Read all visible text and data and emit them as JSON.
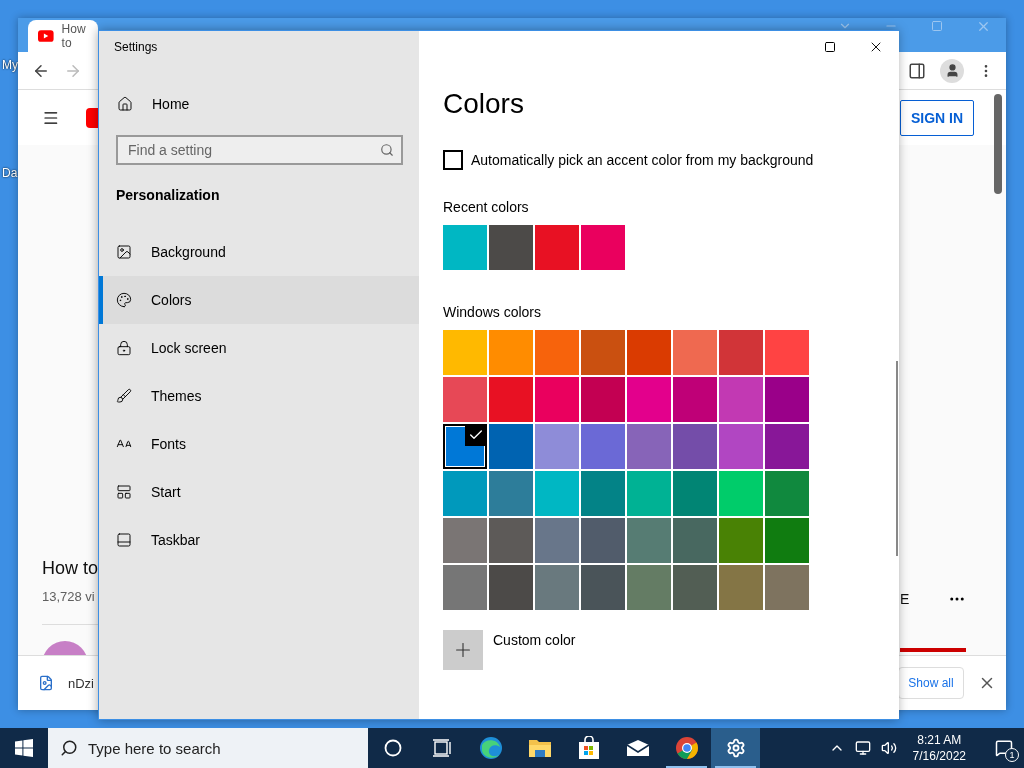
{
  "desktop": {
    "icon_labels": [
      "My",
      "Da"
    ]
  },
  "browser": {
    "tab_title": "How to",
    "sign_in": "SIGN IN",
    "video_title": "How to",
    "views": "13,728 vi",
    "action": "E",
    "download_file": "nDzi",
    "show_all": "Show all"
  },
  "settings": {
    "title": "Settings",
    "home": "Home",
    "search": {
      "placeholder": "Find a setting"
    },
    "section": "Personalization",
    "nav": [
      {
        "label": "Background",
        "kind": "image",
        "selected": false
      },
      {
        "label": "Colors",
        "kind": "palette",
        "selected": true
      },
      {
        "label": "Lock screen",
        "kind": "lock",
        "selected": false
      },
      {
        "label": "Themes",
        "kind": "brush",
        "selected": false
      },
      {
        "label": "Fonts",
        "kind": "fonts",
        "selected": false
      },
      {
        "label": "Start",
        "kind": "start",
        "selected": false
      },
      {
        "label": "Taskbar",
        "kind": "taskbar",
        "selected": false
      }
    ],
    "page": {
      "title": "Colors",
      "auto_accent": {
        "label": "Automatically pick an accent color from my background",
        "checked": false
      },
      "recent_label": "Recent colors",
      "recent_colors": [
        {
          "color": "#00b7c3"
        },
        {
          "color": "#4c4a48"
        },
        {
          "color": "#e81123"
        },
        {
          "color": "#ea005e"
        }
      ],
      "windows_label": "Windows colors",
      "windows_colors": [
        {
          "color": "#ffb900",
          "selected": false
        },
        {
          "color": "#ff8c00",
          "selected": false
        },
        {
          "color": "#f7630c",
          "selected": false
        },
        {
          "color": "#ca5010",
          "selected": false
        },
        {
          "color": "#da3b01",
          "selected": false
        },
        {
          "color": "#ef6950",
          "selected": false
        },
        {
          "color": "#d13438",
          "selected": false
        },
        {
          "color": "#ff4343",
          "selected": false
        },
        {
          "color": "#e74856",
          "selected": false
        },
        {
          "color": "#e81123",
          "selected": false
        },
        {
          "color": "#ea005e",
          "selected": false
        },
        {
          "color": "#c30052",
          "selected": false
        },
        {
          "color": "#e3008c",
          "selected": false
        },
        {
          "color": "#bf0077",
          "selected": false
        },
        {
          "color": "#c239b3",
          "selected": false
        },
        {
          "color": "#9a0089",
          "selected": false
        },
        {
          "color": "#0078d7",
          "selected": true
        },
        {
          "color": "#0063b1",
          "selected": false
        },
        {
          "color": "#8e8cd8",
          "selected": false
        },
        {
          "color": "#6b69d6",
          "selected": false
        },
        {
          "color": "#8764b8",
          "selected": false
        },
        {
          "color": "#744da9",
          "selected": false
        },
        {
          "color": "#b146c2",
          "selected": false
        },
        {
          "color": "#881798",
          "selected": false
        },
        {
          "color": "#0099bc",
          "selected": false
        },
        {
          "color": "#2d7d9a",
          "selected": false
        },
        {
          "color": "#00b7c3",
          "selected": false
        },
        {
          "color": "#038387",
          "selected": false
        },
        {
          "color": "#00b294",
          "selected": false
        },
        {
          "color": "#018574",
          "selected": false
        },
        {
          "color": "#00cc6a",
          "selected": false
        },
        {
          "color": "#10893e",
          "selected": false
        },
        {
          "color": "#7a7574",
          "selected": false
        },
        {
          "color": "#5d5a58",
          "selected": false
        },
        {
          "color": "#68768a",
          "selected": false
        },
        {
          "color": "#515c6b",
          "selected": false
        },
        {
          "color": "#567c73",
          "selected": false
        },
        {
          "color": "#486860",
          "selected": false
        },
        {
          "color": "#498205",
          "selected": false
        },
        {
          "color": "#107c10",
          "selected": false
        },
        {
          "color": "#767676",
          "selected": false
        },
        {
          "color": "#4c4a48",
          "selected": false
        },
        {
          "color": "#69797e",
          "selected": false
        },
        {
          "color": "#4a5459",
          "selected": false
        },
        {
          "color": "#647c64",
          "selected": false
        },
        {
          "color": "#525e54",
          "selected": false
        },
        {
          "color": "#847545",
          "selected": false
        },
        {
          "color": "#7e735f",
          "selected": false
        }
      ],
      "custom_color": "Custom color"
    }
  },
  "taskbar": {
    "search": {
      "placeholder": "Type here to search"
    },
    "apps": [
      {
        "kind": "cortana",
        "running": false,
        "selected": false
      },
      {
        "kind": "taskview",
        "running": false,
        "selected": false
      },
      {
        "kind": "edge",
        "running": false,
        "selected": false
      },
      {
        "kind": "explorer",
        "running": false,
        "selected": false
      },
      {
        "kind": "store",
        "running": false,
        "selected": false
      },
      {
        "kind": "mail",
        "running": false,
        "selected": false
      },
      {
        "kind": "chrome",
        "running": true,
        "selected": false
      },
      {
        "kind": "settings",
        "running": true,
        "selected": true
      }
    ],
    "clock": {
      "time": "8:21 AM",
      "date": "7/16/2022"
    },
    "notifications": "1"
  }
}
